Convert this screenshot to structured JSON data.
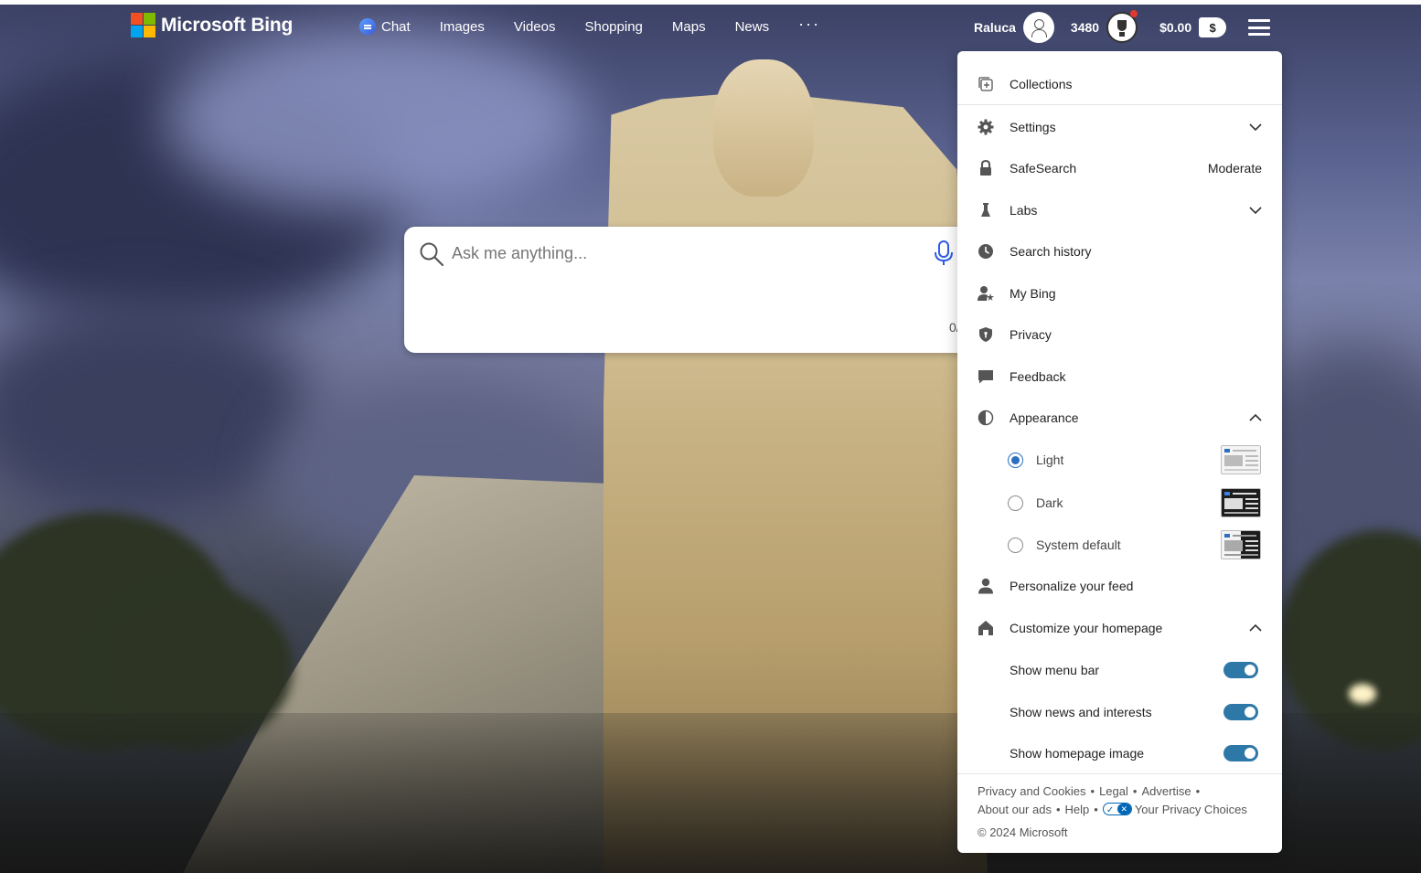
{
  "header": {
    "logo_text": "Microsoft Bing",
    "nav": [
      {
        "label": "Chat",
        "icon": "chat-icon"
      },
      {
        "label": "Images"
      },
      {
        "label": "Videos"
      },
      {
        "label": "Shopping"
      },
      {
        "label": "Maps"
      },
      {
        "label": "News"
      }
    ],
    "more_label": "···",
    "user_name": "Raluca",
    "points": "3480",
    "balance": "$0.00",
    "balance_badge": "$"
  },
  "search": {
    "placeholder": "Ask me anything...",
    "char_count": "0/"
  },
  "menu": {
    "collections": "Collections",
    "settings": "Settings",
    "safesearch": "SafeSearch",
    "safesearch_value": "Moderate",
    "labs": "Labs",
    "search_history": "Search history",
    "my_bing": "My Bing",
    "privacy": "Privacy",
    "feedback": "Feedback",
    "appearance": "Appearance",
    "appearance_options": [
      {
        "label": "Light",
        "selected": true
      },
      {
        "label": "Dark",
        "selected": false
      },
      {
        "label": "System default",
        "selected": false
      }
    ],
    "personalize_feed": "Personalize your feed",
    "customize_homepage": "Customize your homepage",
    "toggles": [
      {
        "label": "Show menu bar",
        "on": true
      },
      {
        "label": "Show news and interests",
        "on": true
      },
      {
        "label": "Show homepage image",
        "on": true
      }
    ]
  },
  "footer": {
    "links_row1": [
      "Privacy and Cookies",
      "Legal",
      "Advertise"
    ],
    "links_row2": [
      "About our ads",
      "Help"
    ],
    "privacy_choices": "Your Privacy Choices",
    "separator": "•",
    "copyright": "© 2024 Microsoft"
  },
  "colors": {
    "accent": "#2a6fc0",
    "toggle_on": "#2e78a8",
    "rewards_dot": "#e23a2c"
  }
}
